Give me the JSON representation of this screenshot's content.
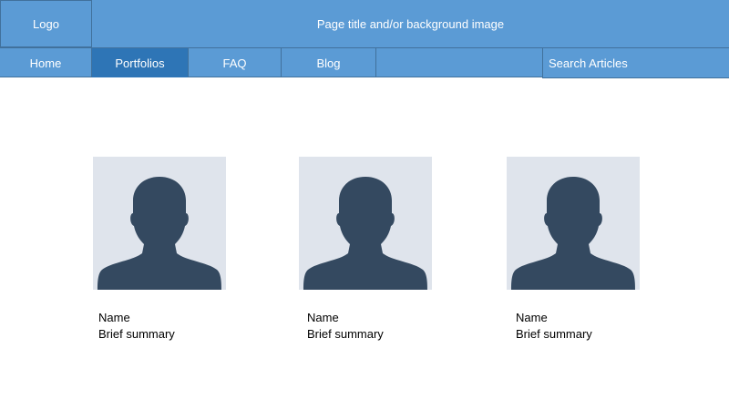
{
  "header": {
    "logo": "Logo",
    "page_title": "Page title and/or background image"
  },
  "nav": {
    "items": [
      {
        "label": "Home"
      },
      {
        "label": "Portfolios",
        "active": true
      },
      {
        "label": "FAQ"
      },
      {
        "label": "Blog"
      }
    ],
    "search_placeholder": "Search Articles"
  },
  "profiles": [
    {
      "name": "Name",
      "summary": "Brief summary",
      "icon": "person-silhouette-icon"
    },
    {
      "name": "Name",
      "summary": "Brief summary",
      "icon": "person-silhouette-icon"
    },
    {
      "name": "Name",
      "summary": "Brief summary",
      "icon": "person-silhouette-icon"
    }
  ],
  "colors": {
    "header_bg": "#5b9bd5",
    "active_tab": "#2e75b6",
    "border": "#41719c",
    "avatar_bg": "#dfe4ec",
    "silhouette": "#344960"
  }
}
